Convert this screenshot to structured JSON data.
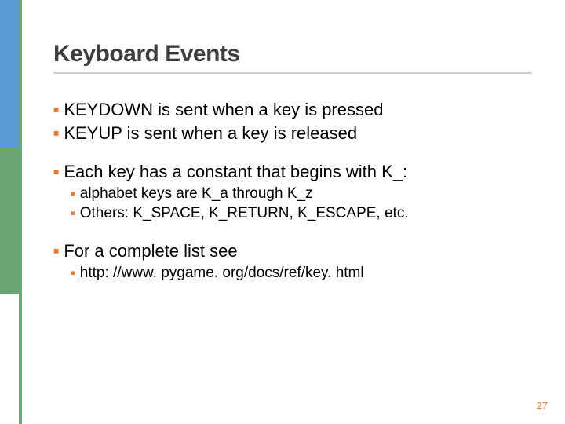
{
  "title": "Keyboard Events",
  "bullets": {
    "a": "KEYDOWN is sent when a key is pressed",
    "b": "KEYUP is sent when a key is released",
    "c": "Each key has a constant that begins with K_:",
    "c1": "alphabet keys are K_a through K_z",
    "c2": "Others: K_SPACE, K_RETURN, K_ESCAPE, etc.",
    "d": "For a complete list see",
    "d1": "http: //www. pygame. org/docs/ref/key. html"
  },
  "page_number": "27"
}
